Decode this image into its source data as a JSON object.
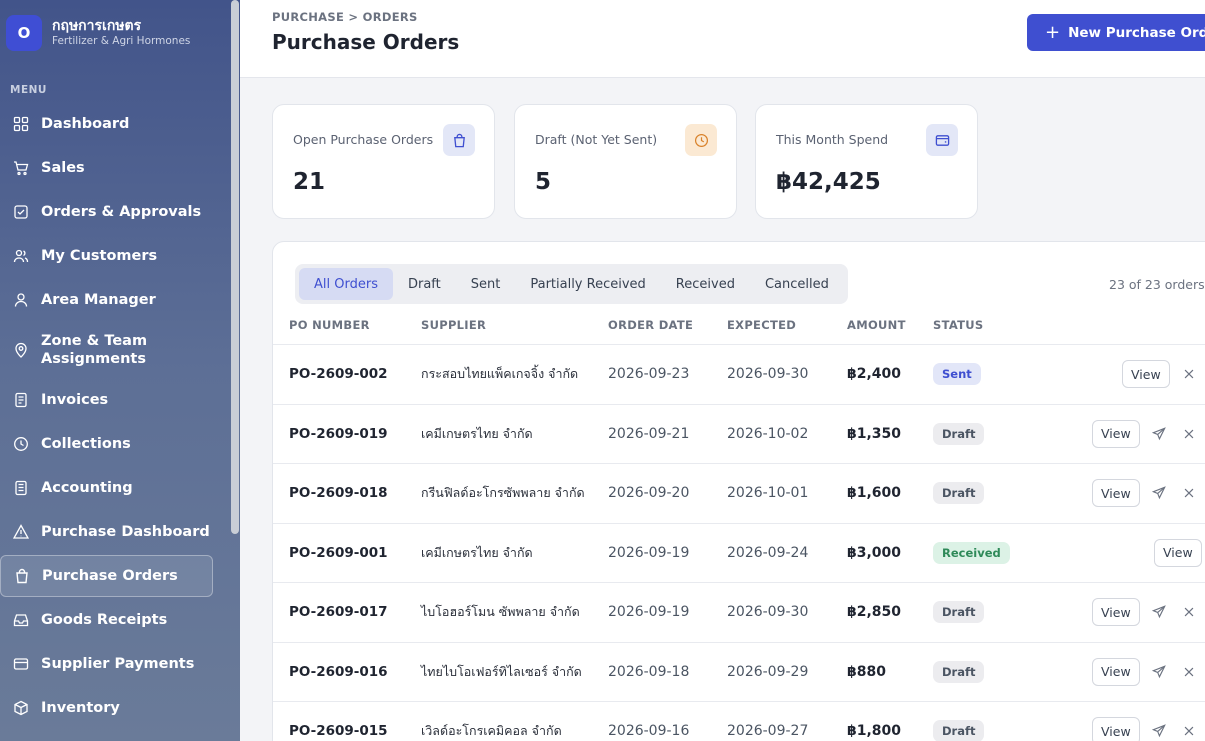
{
  "brand": {
    "logo_letter": "O",
    "name": "กฤษการเกษตร",
    "subtitle": "Fertilizer & Agri Hormones"
  },
  "sidebar": {
    "menu_label": "MENU",
    "items": [
      {
        "label": "Dashboard",
        "icon": "grid-icon"
      },
      {
        "label": "Sales",
        "icon": "cart-icon"
      },
      {
        "label": "Orders & Approvals",
        "icon": "check-square-icon"
      },
      {
        "label": "My Customers",
        "icon": "users-icon"
      },
      {
        "label": "Area Manager",
        "icon": "user-icon"
      },
      {
        "label": "Zone & Team Assignments",
        "icon": "map-pin-icon"
      },
      {
        "label": "Invoices",
        "icon": "document-icon"
      },
      {
        "label": "Collections",
        "icon": "clock-icon"
      },
      {
        "label": "Accounting",
        "icon": "ledger-icon"
      },
      {
        "label": "Purchase Dashboard",
        "icon": "alert-triangle-icon"
      },
      {
        "label": "Purchase Orders",
        "icon": "shopping-bag-icon",
        "active": true
      },
      {
        "label": "Goods Receipts",
        "icon": "inbox-icon"
      },
      {
        "label": "Supplier Payments",
        "icon": "credit-card-icon"
      },
      {
        "label": "Inventory",
        "icon": "box-icon"
      }
    ]
  },
  "header": {
    "breadcrumb": "PURCHASE > ORDERS",
    "title": "Purchase Orders",
    "new_button": "New Purchase Order"
  },
  "stats": [
    {
      "label": "Open Purchase Orders",
      "value": "21",
      "icon": "shopping-bag-icon",
      "icon_bg": "#e3e7f7",
      "icon_color": "#3f4fd0"
    },
    {
      "label": "Draft (Not Yet Sent)",
      "value": "5",
      "icon": "clock-icon",
      "icon_bg": "#fbe9d3",
      "icon_color": "#d9822b"
    },
    {
      "label": "This Month Spend",
      "value": "฿42,425",
      "icon": "wallet-icon",
      "icon_bg": "#e3e7f7",
      "icon_color": "#3f4fd0"
    }
  ],
  "tabs": [
    "All Orders",
    "Draft",
    "Sent",
    "Partially Received",
    "Received",
    "Cancelled"
  ],
  "active_tab": "All Orders",
  "order_count": "23 of 23 orders",
  "columns": [
    "PO NUMBER",
    "SUPPLIER",
    "ORDER DATE",
    "EXPECTED",
    "AMOUNT",
    "STATUS"
  ],
  "view_label": "View",
  "orders": [
    {
      "po": "PO-2609-002",
      "supplier": "กระสอบไทยแพ็คเกจจิ้ง จำกัด",
      "order_date": "2026-09-23",
      "expected": "2026-09-30",
      "amount": "฿2,400",
      "status": "Sent"
    },
    {
      "po": "PO-2609-019",
      "supplier": "เคมีเกษตรไทย จำกัด",
      "order_date": "2026-09-21",
      "expected": "2026-10-02",
      "amount": "฿1,350",
      "status": "Draft"
    },
    {
      "po": "PO-2609-018",
      "supplier": "กรีนฟิลด์อะโกรซัพพลาย จำกัด",
      "order_date": "2026-09-20",
      "expected": "2026-10-01",
      "amount": "฿1,600",
      "status": "Draft"
    },
    {
      "po": "PO-2609-001",
      "supplier": "เคมีเกษตรไทย จำกัด",
      "order_date": "2026-09-19",
      "expected": "2026-09-24",
      "amount": "฿3,000",
      "status": "Received"
    },
    {
      "po": "PO-2609-017",
      "supplier": "ไบโอฮอร์โมน ซัพพลาย จำกัด",
      "order_date": "2026-09-19",
      "expected": "2026-09-30",
      "amount": "฿2,850",
      "status": "Draft"
    },
    {
      "po": "PO-2609-016",
      "supplier": "ไทยไบโอเฟอร์ทิไลเซอร์ จำกัด",
      "order_date": "2026-09-18",
      "expected": "2026-09-29",
      "amount": "฿880",
      "status": "Draft"
    },
    {
      "po": "PO-2609-015",
      "supplier": "เวิลด์อะโกรเคมิคอล จำกัด",
      "order_date": "2026-09-16",
      "expected": "2026-09-27",
      "amount": "฿1,800",
      "status": "Draft"
    }
  ]
}
